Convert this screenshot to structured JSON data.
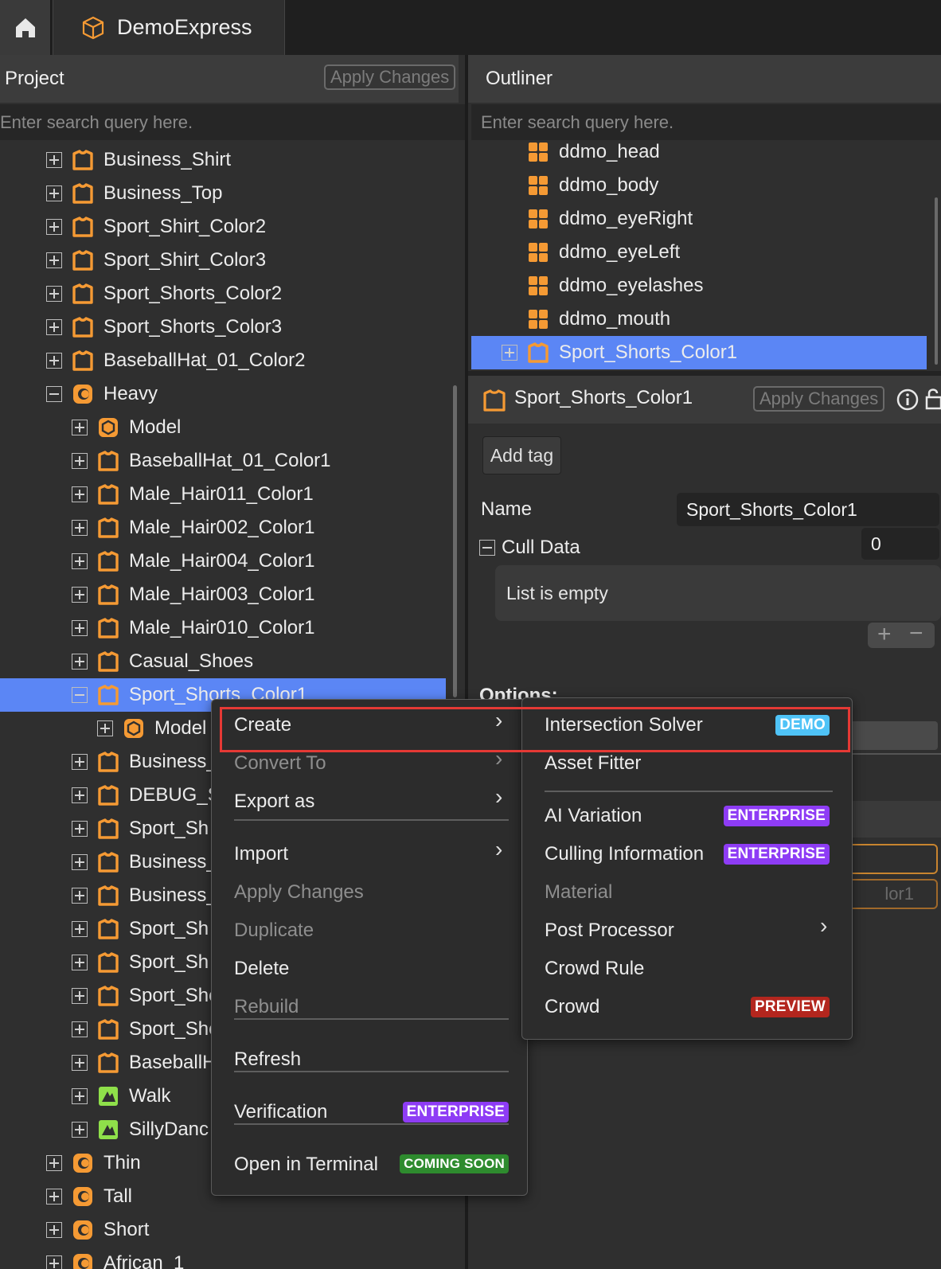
{
  "app": {
    "tab_title": "DemoExpress"
  },
  "project": {
    "title": "Project",
    "apply_label": "Apply Changes",
    "search_placeholder": "Enter search query here.",
    "tree": [
      {
        "label": "Business_Shirt",
        "level": 2,
        "icon": "shirt-icon",
        "expander": "plus"
      },
      {
        "label": "Business_Top",
        "level": 2,
        "icon": "shirt-icon",
        "expander": "plus"
      },
      {
        "label": "Sport_Shirt_Color2",
        "level": 2,
        "icon": "shirt-icon",
        "expander": "plus"
      },
      {
        "label": "Sport_Shirt_Color3",
        "level": 2,
        "icon": "shirt-icon",
        "expander": "plus"
      },
      {
        "label": "Sport_Shorts_Color2",
        "level": 2,
        "icon": "shirt-icon",
        "expander": "plus"
      },
      {
        "label": "Sport_Shorts_Color3",
        "level": 2,
        "icon": "shirt-icon",
        "expander": "plus"
      },
      {
        "label": "BaseballHat_01_Color2",
        "level": 2,
        "icon": "shirt-icon",
        "expander": "plus"
      },
      {
        "label": "Heavy",
        "level": 2,
        "icon": "character-icon",
        "expander": "minus"
      },
      {
        "label": "Model",
        "level": 3,
        "icon": "model-icon",
        "expander": "plus"
      },
      {
        "label": "BaseballHat_01_Color1",
        "level": 3,
        "icon": "shirt-icon",
        "expander": "plus"
      },
      {
        "label": "Male_Hair011_Color1",
        "level": 3,
        "icon": "shirt-icon",
        "expander": "plus"
      },
      {
        "label": "Male_Hair002_Color1",
        "level": 3,
        "icon": "shirt-icon",
        "expander": "plus"
      },
      {
        "label": "Male_Hair004_Color1",
        "level": 3,
        "icon": "shirt-icon",
        "expander": "plus"
      },
      {
        "label": "Male_Hair003_Color1",
        "level": 3,
        "icon": "shirt-icon",
        "expander": "plus"
      },
      {
        "label": "Male_Hair010_Color1",
        "level": 3,
        "icon": "shirt-icon",
        "expander": "plus"
      },
      {
        "label": "Casual_Shoes",
        "level": 3,
        "icon": "shirt-icon",
        "expander": "plus"
      },
      {
        "label": "Sport_Shorts_Color1",
        "level": 3,
        "icon": "shirt-icon",
        "expander": "minus",
        "selected": true
      },
      {
        "label": "Model",
        "level": 4,
        "icon": "model-icon",
        "expander": "plus"
      },
      {
        "label": "Business_",
        "level": 3,
        "icon": "shirt-icon",
        "expander": "plus"
      },
      {
        "label": "DEBUG_S",
        "level": 3,
        "icon": "shirt-icon",
        "expander": "plus"
      },
      {
        "label": "Sport_Sh",
        "level": 3,
        "icon": "shirt-icon",
        "expander": "plus"
      },
      {
        "label": "Business_",
        "level": 3,
        "icon": "shirt-icon",
        "expander": "plus"
      },
      {
        "label": "Business_",
        "level": 3,
        "icon": "shirt-icon",
        "expander": "plus"
      },
      {
        "label": "Sport_Sh",
        "level": 3,
        "icon": "shirt-icon",
        "expander": "plus"
      },
      {
        "label": "Sport_Sh",
        "level": 3,
        "icon": "shirt-icon",
        "expander": "plus"
      },
      {
        "label": "Sport_Sho",
        "level": 3,
        "icon": "shirt-icon",
        "expander": "plus"
      },
      {
        "label": "Sport_Sho",
        "level": 3,
        "icon": "shirt-icon",
        "expander": "plus"
      },
      {
        "label": "BaseballH",
        "level": 3,
        "icon": "shirt-icon",
        "expander": "plus"
      },
      {
        "label": "Walk",
        "level": 3,
        "icon": "animation-icon",
        "expander": "plus"
      },
      {
        "label": "SillyDanc",
        "level": 3,
        "icon": "animation-icon",
        "expander": "plus"
      },
      {
        "label": "Thin",
        "level": 2,
        "icon": "character-icon",
        "expander": "plus"
      },
      {
        "label": "Tall",
        "level": 2,
        "icon": "character-icon",
        "expander": "plus"
      },
      {
        "label": "Short",
        "level": 2,
        "icon": "character-icon",
        "expander": "plus"
      },
      {
        "label": "African_1",
        "level": 2,
        "icon": "character-icon",
        "expander": "plus"
      }
    ]
  },
  "outliner": {
    "title": "Outliner",
    "search_placeholder": "Enter search query here.",
    "items": [
      {
        "label": "ddmo_head",
        "icon": "mesh-grid-icon"
      },
      {
        "label": "ddmo_body",
        "icon": "mesh-grid-icon"
      },
      {
        "label": "ddmo_eyeRight",
        "icon": "mesh-grid-icon"
      },
      {
        "label": "ddmo_eyeLeft",
        "icon": "mesh-grid-icon"
      },
      {
        "label": "ddmo_eyelashes",
        "icon": "mesh-grid-icon"
      },
      {
        "label": "ddmo_mouth",
        "icon": "mesh-grid-icon"
      },
      {
        "label": "Sport_Shorts_Color1",
        "icon": "shirt-icon",
        "selected": true
      }
    ]
  },
  "inspector": {
    "title": "Sport_Shorts_Color1",
    "apply_label": "Apply Changes",
    "add_tag_label": "Add tag",
    "name_label": "Name",
    "name_value": "Sport_Shorts_Color1",
    "cull_label": "Cull Data",
    "cull_value": "0",
    "list_empty": "List is empty",
    "options_label": "Options:",
    "partial_text": "lor1"
  },
  "context_menu": {
    "items": [
      {
        "label": "Create",
        "submenu": true,
        "highlighted": true
      },
      {
        "label": "Convert To",
        "submenu": true,
        "disabled": true
      },
      {
        "label": "Export as",
        "submenu": true
      },
      {
        "label": "Import",
        "submenu": true
      },
      {
        "label": "Apply Changes",
        "disabled": true
      },
      {
        "label": "Duplicate",
        "disabled": true
      },
      {
        "label": "Delete"
      },
      {
        "label": "Rebuild",
        "disabled": true
      },
      {
        "label": "Refresh"
      },
      {
        "label": "Verification",
        "badge": "ENTERPRISE"
      },
      {
        "label": "Open in Terminal",
        "badge": "COMING SOON"
      }
    ]
  },
  "submenu": {
    "items": [
      {
        "label": "Intersection Solver",
        "badge": "DEMO"
      },
      {
        "label": "Asset Fitter"
      },
      {
        "label": "AI Variation",
        "badge": "ENTERPRISE"
      },
      {
        "label": "Culling Information",
        "badge": "ENTERPRISE"
      },
      {
        "label": "Material",
        "disabled": true
      },
      {
        "label": "Post Processor",
        "submenu": true
      },
      {
        "label": "Crowd Rule"
      },
      {
        "label": "Crowd",
        "badge": "PREVIEW"
      }
    ]
  },
  "colors": {
    "selection": "#5b86f5",
    "accent_orange": "#f59a34",
    "highlight_red": "#e53935"
  }
}
